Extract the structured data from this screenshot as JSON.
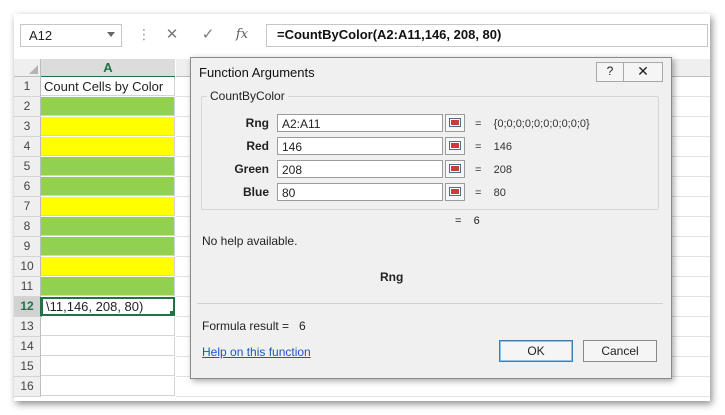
{
  "formula_bar": {
    "name_box": "A12",
    "cancel_glyph": "✕",
    "enter_glyph": "✓",
    "fx_glyph": "fx",
    "formula": "=CountByColor(A2:A11,146, 208, 80)"
  },
  "sheet": {
    "column_header": "A",
    "rows": [
      {
        "num": "1",
        "text": "Count Cells by Color",
        "fill": "#ffffff"
      },
      {
        "num": "2",
        "text": "",
        "fill": "#92d050"
      },
      {
        "num": "3",
        "text": "",
        "fill": "#ffff00"
      },
      {
        "num": "4",
        "text": "",
        "fill": "#ffff00"
      },
      {
        "num": "5",
        "text": "",
        "fill": "#92d050"
      },
      {
        "num": "6",
        "text": "",
        "fill": "#92d050"
      },
      {
        "num": "7",
        "text": "",
        "fill": "#ffff00"
      },
      {
        "num": "8",
        "text": "",
        "fill": "#92d050"
      },
      {
        "num": "9",
        "text": "",
        "fill": "#92d050"
      },
      {
        "num": "10",
        "text": "",
        "fill": "#ffff00"
      },
      {
        "num": "11",
        "text": "",
        "fill": "#92d050"
      },
      {
        "num": "12",
        "text": "\\11,146, 208, 80)",
        "fill": "#ffffff"
      },
      {
        "num": "13",
        "text": "",
        "fill": "#ffffff"
      },
      {
        "num": "14",
        "text": "",
        "fill": "#ffffff"
      },
      {
        "num": "15",
        "text": "",
        "fill": "#ffffff"
      },
      {
        "num": "16",
        "text": "",
        "fill": "#ffffff"
      }
    ]
  },
  "dialog": {
    "title": "Function Arguments",
    "help_glyph": "?",
    "close_glyph": "✕",
    "function_name": "CountByColor",
    "args": [
      {
        "label": "Rng",
        "value": "A2:A11",
        "result": "{0;0;0;0;0;0;0;0;0;0}"
      },
      {
        "label": "Red",
        "value": "146",
        "result": "146"
      },
      {
        "label": "Green",
        "value": "208",
        "result": "208"
      },
      {
        "label": "Blue",
        "value": "80",
        "result": "80"
      }
    ],
    "equals": "=",
    "overall_result": "6",
    "help_text": "No help available.",
    "current_arg": "Rng",
    "formula_result_label": "Formula result =",
    "formula_result_value": "6",
    "help_link": "Help on this function",
    "ok_label": "OK",
    "cancel_label": "Cancel"
  },
  "colors": {
    "excel_green": "#217346",
    "cell_green": "#92d050",
    "cell_yellow": "#ffff00",
    "link_blue": "#1a56c7"
  }
}
